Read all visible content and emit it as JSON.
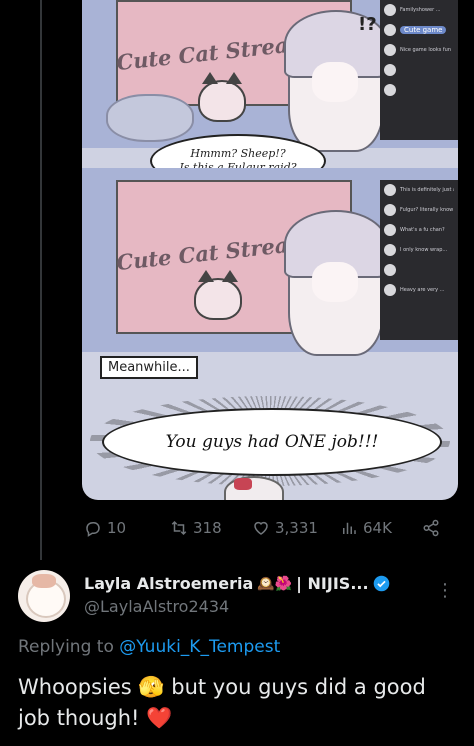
{
  "post": {
    "comic": {
      "stream_title": "Cute Cat Stream",
      "panel1": {
        "chat_items": [
          {
            "text": "Familyshower ..."
          },
          {
            "text": "Cute game"
          },
          {
            "text": "Nice game looks fun"
          },
          {
            "text": ""
          },
          {
            "text": ""
          }
        ],
        "bubble_line1": "Hmmm? Sheep!?",
        "bubble_line2": "Is this a Fulgur raid?"
      },
      "panel2": {
        "chat_items": [
          {
            "text": "This is definitely just a raid"
          },
          {
            "text": "Fulgur? literally know her"
          },
          {
            "text": "What's a fu chan?"
          },
          {
            "text": "I only know wrap..."
          },
          {
            "text": ""
          },
          {
            "text": "Heavy are very ..."
          }
        ]
      },
      "caption": "Meanwhile...",
      "shout": "You guys had ONE job!!!"
    },
    "stats": {
      "replies": "10",
      "reposts": "318",
      "likes": "3,331",
      "views": "64K"
    }
  },
  "reply": {
    "author_name": "Layla Alstroemeria",
    "author_emoji": "🕰️🌺",
    "author_suffix": "| NIJIS...",
    "handle": "@LaylaAlstro2434",
    "replying_prefix": "Replying to ",
    "replying_to": "@Yuuki_K_Tempest",
    "text_part1": "Whoopsies ",
    "emoji1": "🫣",
    "text_part2": " but you guys did a good job though! ",
    "emoji2": "❤️"
  }
}
